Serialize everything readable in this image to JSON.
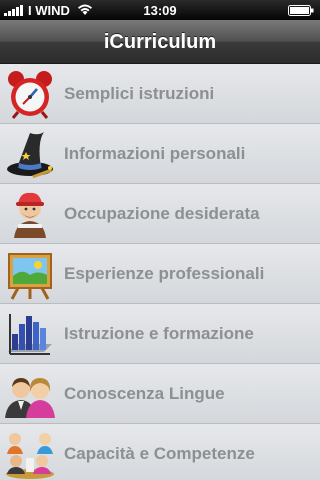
{
  "status_bar": {
    "carrier": "I WIND",
    "time": "13:09"
  },
  "nav": {
    "title": "iCurriculum"
  },
  "menu": {
    "items": [
      {
        "label": "Semplici istruzioni",
        "icon": "alarm-clock-icon"
      },
      {
        "label": "Informazioni personali",
        "icon": "wizard-hat-icon"
      },
      {
        "label": "Occupazione desiderata",
        "icon": "worker-icon"
      },
      {
        "label": "Esperienze professionali",
        "icon": "easel-landscape-icon"
      },
      {
        "label": "Istruzione e formazione",
        "icon": "bar-chart-icon"
      },
      {
        "label": "Conoscenza Lingue",
        "icon": "people-icon"
      },
      {
        "label": "Capacità e Competenze",
        "icon": "group-icon"
      }
    ]
  },
  "colors": {
    "label": "#8c8f93",
    "row_background": "#dfe1e4",
    "nav_bar": "#3a3a3a"
  }
}
